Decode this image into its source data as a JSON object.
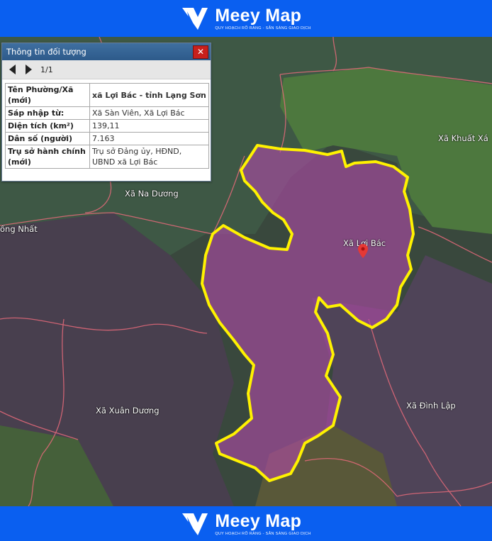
{
  "brand": {
    "name": "Meey Map",
    "tagline": "QUY HOẠCH RÕ RÀNG - SẴN SÀNG GIAO DỊCH"
  },
  "colors": {
    "brand_blue": "#0a5ff0",
    "highlight_outline": "#fff200",
    "highlight_fill": "#a04a9a",
    "boundary": "#e06070",
    "pin": "#e53935"
  },
  "map": {
    "labels": {
      "na_duong": "Xã Na Dương",
      "thong_nhat": "ống Nhất",
      "khuat_xa": "Xã Khuất Xá",
      "loi_bac": "Xã Lợi Bác",
      "xuan_duong": "Xã Xuân Dương",
      "dinh_lap": "Xã Đình Lập"
    },
    "marker_icon": "location-pin-icon"
  },
  "panel": {
    "title": "Thông tin đối tượng",
    "pager": "1/1",
    "close_icon": "close-icon",
    "rows": [
      {
        "key": "Tên Phường/Xã (mới)",
        "value": "xã Lợi Bác - tỉnh Lạng Sơn"
      },
      {
        "key": "Sáp nhập từ:",
        "value": "Xã Sàn Viên, Xã Lợi Bác"
      },
      {
        "key": "Diện tích (km²)",
        "value": "139,11"
      },
      {
        "key": "Dân số (người)",
        "value": "7.163"
      },
      {
        "key": "Trụ sở hành chính (mới)",
        "value": "Trụ sở Đảng ủy, HĐND, UBND xã Lợi Bác"
      }
    ]
  }
}
